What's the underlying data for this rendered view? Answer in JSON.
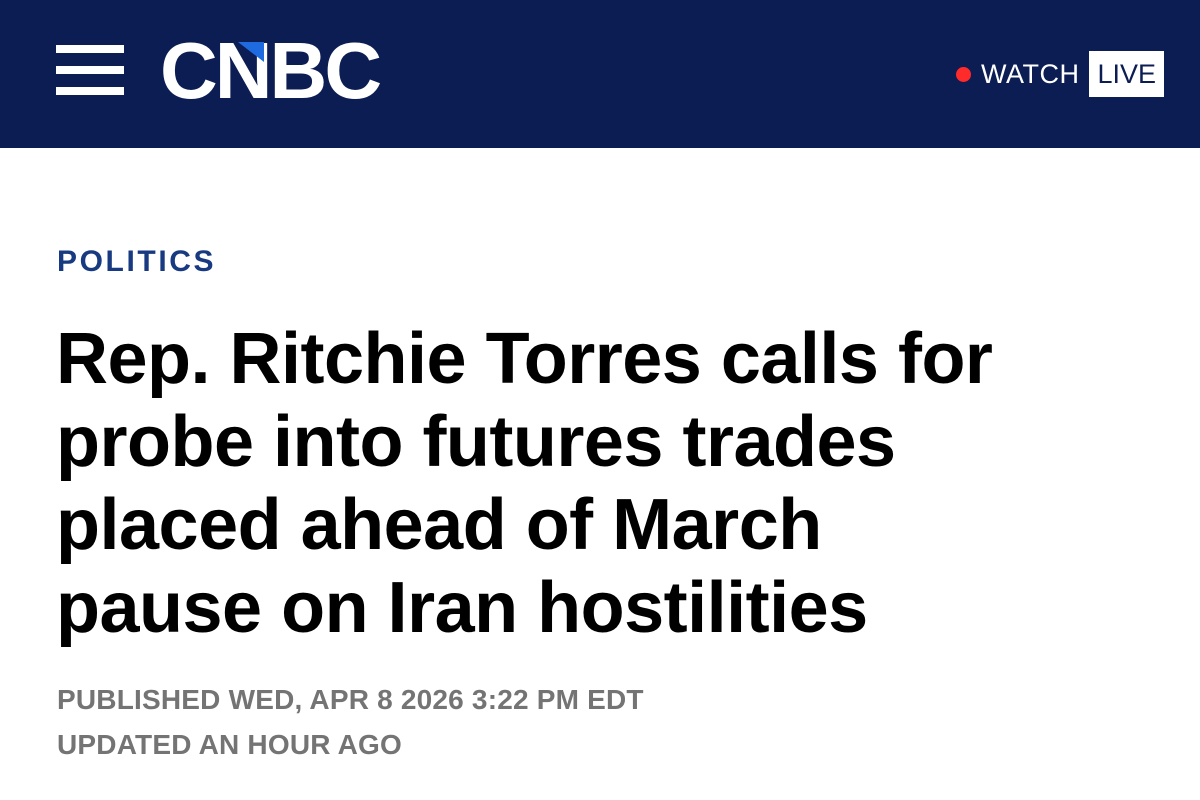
{
  "header": {
    "brand": "CNBC",
    "brand_colors": {
      "bar": "#0c1d53",
      "logo": "#ffffff",
      "peacock_blue": "#1e6be0"
    },
    "menu_icon": "hamburger-menu-icon",
    "watch_label": "WATCH",
    "live_label": "LIVE",
    "live_dot_color": "#ff2a2a"
  },
  "article": {
    "category": "POLITICS",
    "headline_lines": [
      "Rep. Ritchie Torres calls for",
      "probe into futures trades",
      "placed ahead of March",
      "pause on Iran hostilities"
    ],
    "published": "PUBLISHED WED, APR 8 2026 3:22 PM EDT",
    "updated": "UPDATED AN HOUR AGO"
  }
}
